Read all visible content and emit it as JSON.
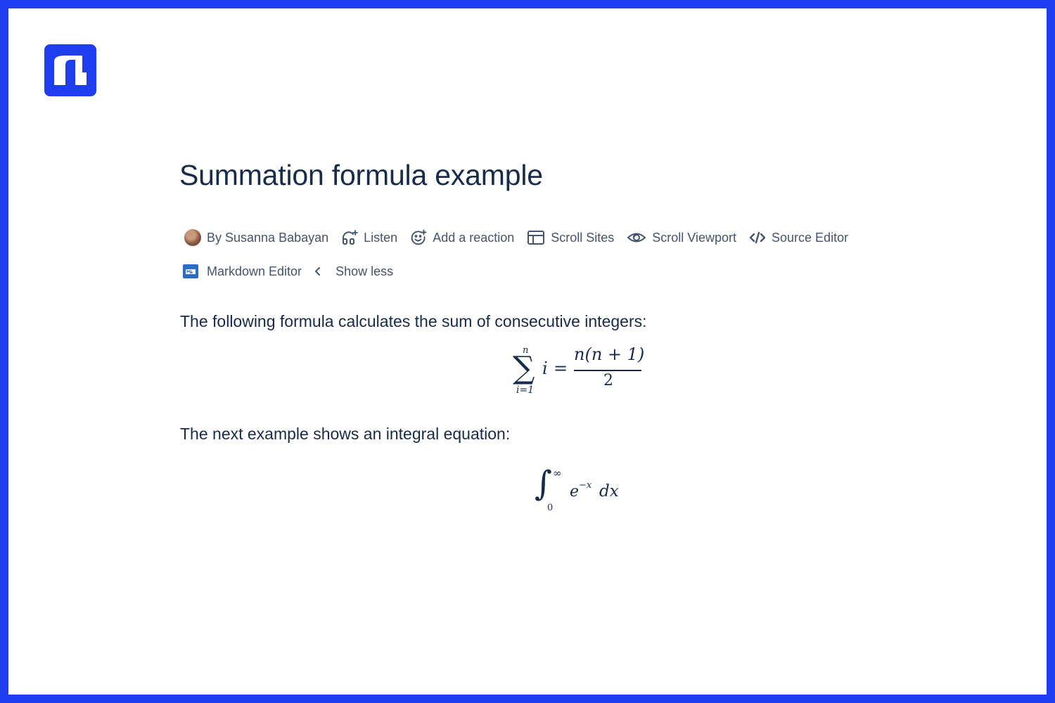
{
  "page": {
    "title": "Summation formula example"
  },
  "colors": {
    "frame": "#1f3ef0",
    "text": "#172b4d",
    "meta_text": "#44546f",
    "markdown_icon": "#2c6cc5"
  },
  "byline": {
    "author": "By Susanna Babayan"
  },
  "actions": {
    "listen": "Listen",
    "add_reaction": "Add a reaction",
    "scroll_sites": "Scroll Sites",
    "scroll_viewport": "Scroll Viewport",
    "source_editor": "Source Editor",
    "markdown_editor": "Markdown Editor",
    "show_less": "Show less"
  },
  "icons": {
    "logo": "app-logo-icon",
    "listen": "headphones-icon",
    "reaction": "add-reaction-icon",
    "scroll_sites": "layout-icon",
    "scroll_viewport": "eye-icon",
    "source_editor": "code-icon",
    "markdown_editor": "markdown-icon",
    "show_less": "chevron-left-icon"
  },
  "content": {
    "paragraph1": "The following formula calculates the sum of consecutive integers:",
    "paragraph2": "The next example shows an integral equation:"
  },
  "formula_sum": {
    "sigma": "∑",
    "upper": "n",
    "lower": "i=1",
    "term": "i",
    "equals": "=",
    "numerator": "n(n + 1)",
    "denominator": "2"
  },
  "formula_integral": {
    "integral": "∫",
    "upper": "∞",
    "lower": "0",
    "base": "e",
    "exponent": "−x",
    "differential": "dx"
  }
}
